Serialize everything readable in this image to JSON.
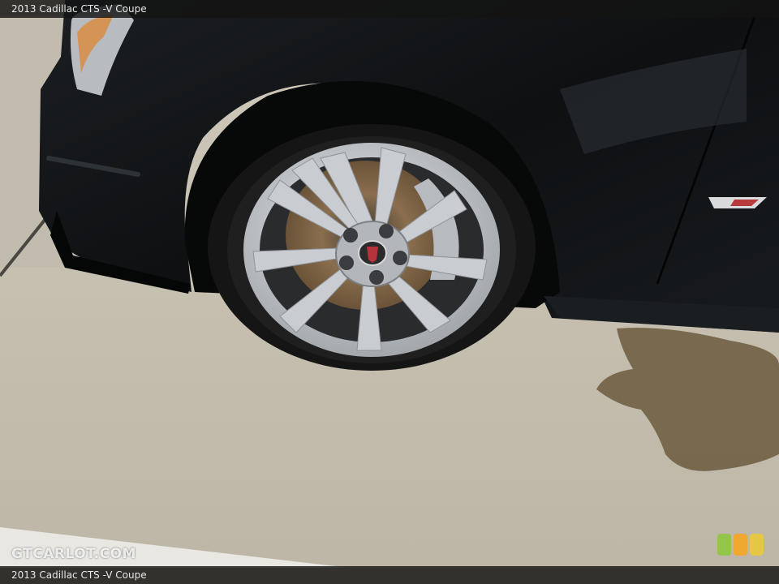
{
  "caption": {
    "top": "2013 Cadillac CTS -V Coupe",
    "bottom": "2013 Cadillac CTS -V Coupe"
  },
  "watermark": {
    "text": "GTCARLOT.COM",
    "squares": [
      "#8dc63f",
      "#f5a623",
      "#e8c93a"
    ]
  },
  "photo": {
    "subject": "front wheel of a black coupe on concrete",
    "colors": {
      "car_body": "#101214",
      "concrete": "#c9c2b2",
      "tire": "#151515",
      "rim": "#c4c8cc",
      "brake_rotor": "#7a6248",
      "wet_stain": "#6b5a3e"
    }
  }
}
